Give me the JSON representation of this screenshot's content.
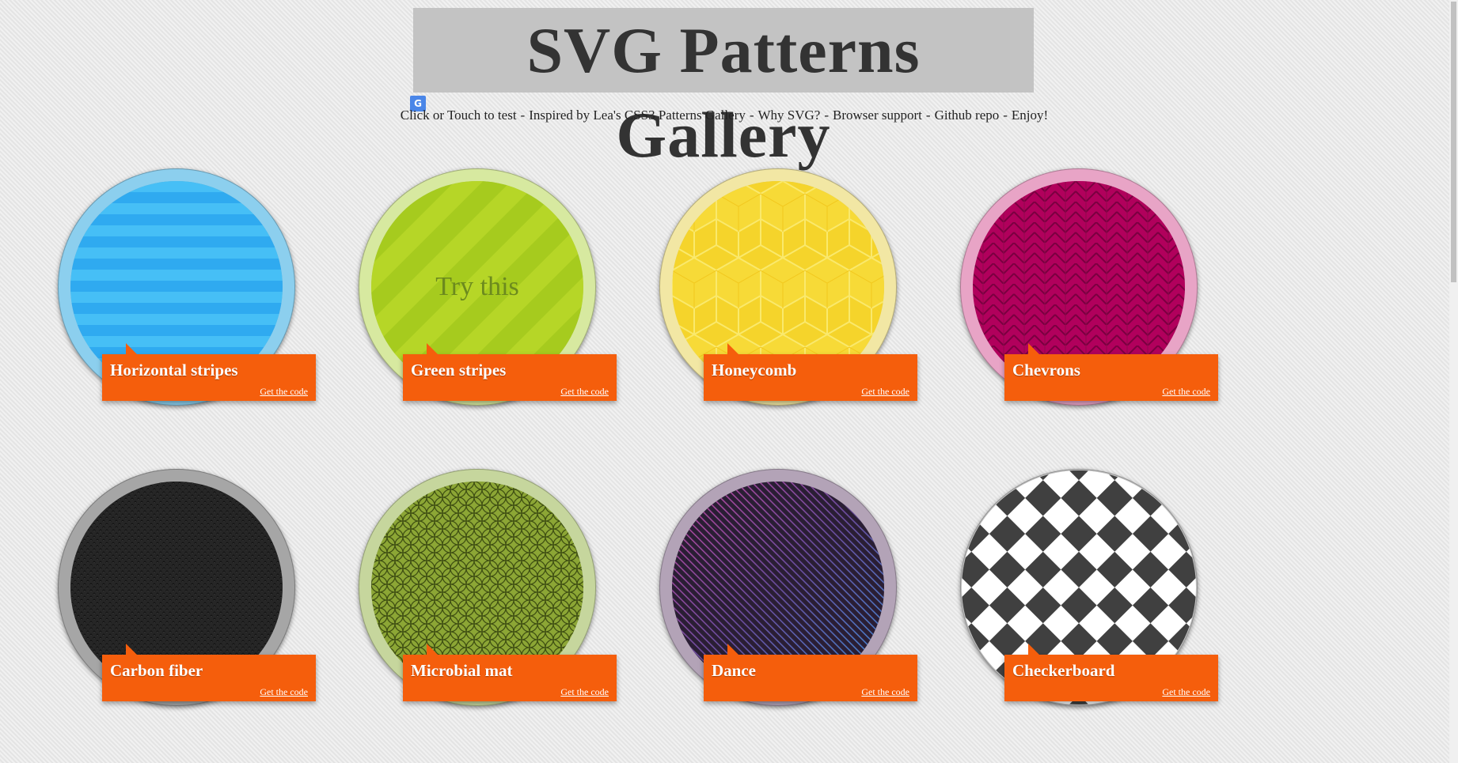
{
  "header": {
    "title": "SVG Patterns Gallery",
    "translate_icon": "translate-icon",
    "nav": [
      "Click or Touch to test",
      "Inspired by Lea's CSS3 Patterns Gallery",
      "Why SVG?",
      "Browser support",
      "Github repo",
      "Enjoy!"
    ],
    "separator": "-"
  },
  "gallery": {
    "link_label": "Get the code",
    "hover_text": "Try this",
    "items": [
      {
        "name": "Horizontal stripes",
        "ring_color": "#8ccfee"
      },
      {
        "name": "Green stripes",
        "ring_color": "#d7e9a0"
      },
      {
        "name": "Honeycomb",
        "ring_color": "#f2e7a4"
      },
      {
        "name": "Chevrons",
        "ring_color": "#e8a4c6"
      },
      {
        "name": "Carbon fiber",
        "ring_color": "#a6a6a6"
      },
      {
        "name": "Microbial mat",
        "ring_color": "#c6d69d"
      },
      {
        "name": "Dance",
        "ring_color": "#b3a3b7"
      },
      {
        "name": "Checkerboard",
        "ring_color": "#c4c4c4"
      }
    ]
  },
  "colors": {
    "ribbon": "#f55e0c",
    "title_highlight": "#c3c3c3"
  }
}
